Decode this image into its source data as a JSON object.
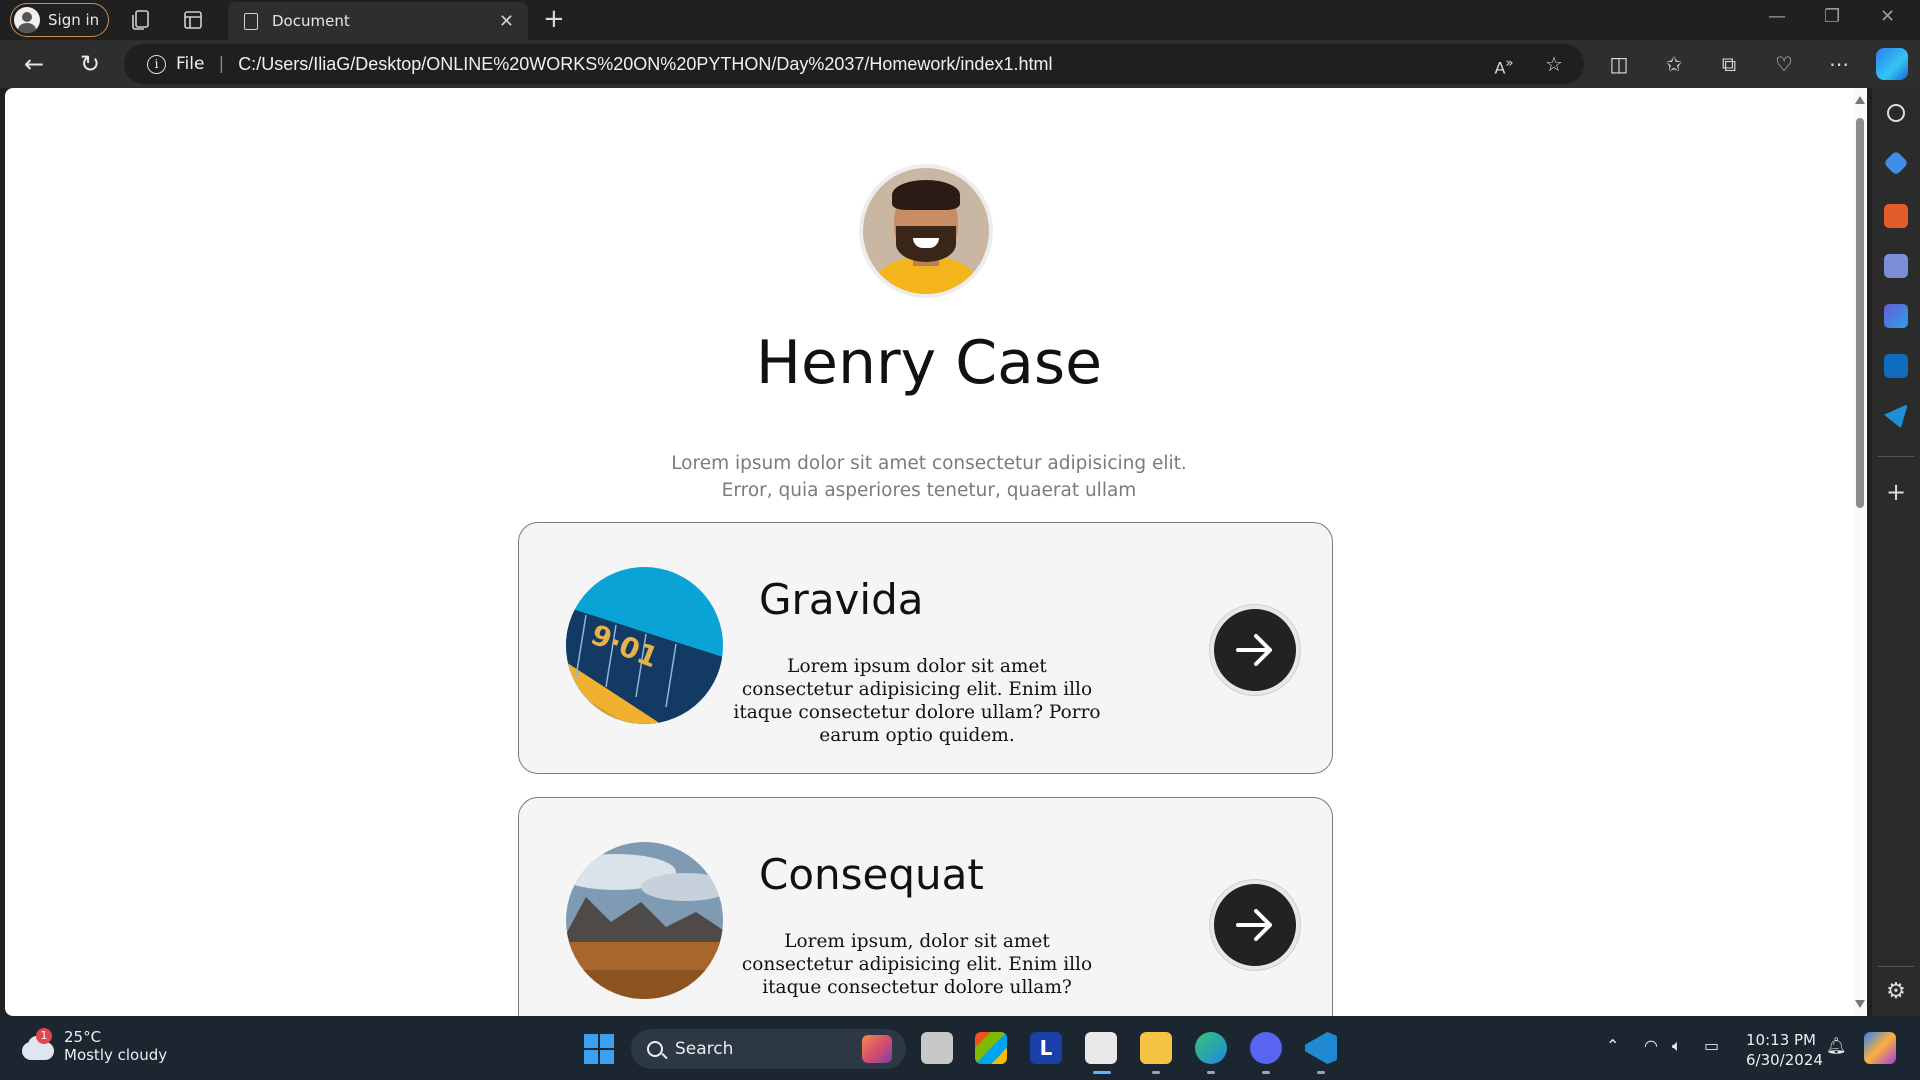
{
  "browser": {
    "sign_in_label": "Sign in",
    "tab_title": "Document",
    "address_scheme": "File",
    "address_url": "C:/Users/IliaG/Desktop/ONLINE%20WORKS%20ON%20PYTHON/Day%2037/Homework/index1.html",
    "colors": {
      "chrome_bg": "#202020",
      "toolbar_bg": "#2e2e2e",
      "accent": "#c98f4e"
    }
  },
  "page": {
    "name": "Henry Case",
    "bio": "Lorem ipsum dolor sit amet consectetur adipisicing elit. Error, quia asperiores tenetur, quaerat ullam",
    "cards": [
      {
        "title": "Gravida",
        "text": "Lorem ipsum dolor sit amet consectetur adipisicing elit. Enim illo itaque consectetur dolore ullam? Porro earum optio quidem.",
        "image_icon": "clock-photo",
        "action_icon": "arrow-right-icon"
      },
      {
        "title": "Consequat",
        "text": "Lorem ipsum, dolor sit amet consectetur adipisicing elit. Enim illo itaque consectetur dolore ullam?",
        "image_icon": "mountain-landscape-photo",
        "action_icon": "arrow-right-icon"
      }
    ]
  },
  "taskbar": {
    "weather_temp": "25°C",
    "weather_desc": "Mostly cloudy",
    "weather_badge": "1",
    "search_placeholder": "Search",
    "time": "10:13 PM",
    "date": "6/30/2024"
  }
}
